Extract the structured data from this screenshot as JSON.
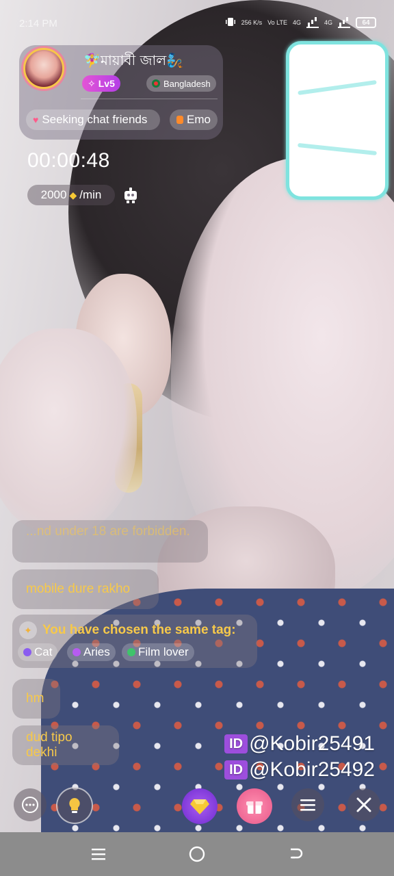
{
  "status_bar": {
    "time": "2:14 PM",
    "network_speed": "256 K/s",
    "volte_label": "Vo LTE",
    "net1": "4G",
    "net2": "4G",
    "battery": "64"
  },
  "host": {
    "name": "🧚‍♀️মায়াবী জাল🧞",
    "level": "Lv5",
    "country": "Bangladesh",
    "tags": [
      "Seeking chat friends",
      "Emo"
    ]
  },
  "call": {
    "timer": "00:00:48",
    "rate_value": "2000",
    "rate_unit": "/min"
  },
  "chat": {
    "warning": "...nd under 18 are forbidden.",
    "messages": [
      "mobile dure rakho",
      "hm",
      "dud tipo dekhi"
    ],
    "same_tag": {
      "title": "You have chosen the same tag:",
      "tags": [
        {
          "label": "Cat",
          "color": "#8a5cf0"
        },
        {
          "label": "Aries",
          "color": "#b65cf0"
        },
        {
          "label": "Film lover",
          "color": "#3fc46b"
        }
      ]
    }
  },
  "watermark": {
    "badge": "ID",
    "ids": [
      "@Kobir25491",
      "@Kobir25492"
    ]
  },
  "controls": {
    "icons": [
      "chat-icon",
      "bulb-icon",
      "diamond-icon",
      "gift-icon",
      "menu-icon",
      "close-icon"
    ]
  },
  "colors": {
    "accent_yellow": "#f7c94a",
    "level_purple": "#c94ae3",
    "id_badge": "#9d4edd",
    "gift_pink": "#e8588a"
  }
}
